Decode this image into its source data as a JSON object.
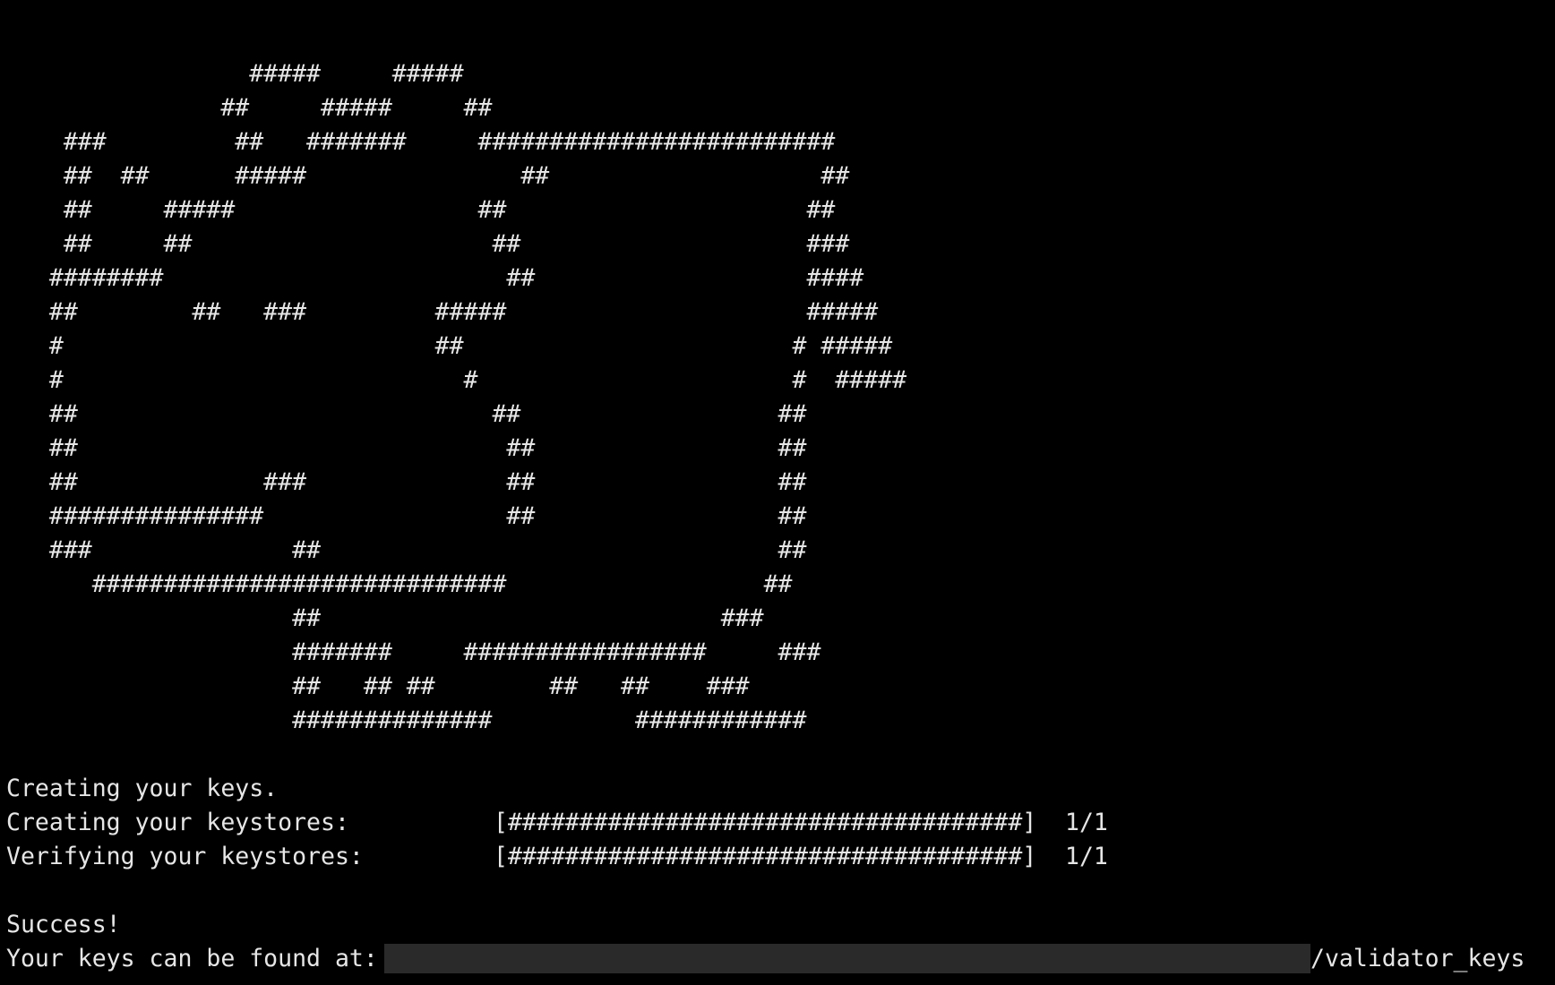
{
  "banner_art": [
    "                 #####     #####",
    "               ##     #####     ##",
    "    ###         ##   #######     #########################",
    "    ##  ##      #####               ##                   ##",
    "    ##     #####                 ##                     ##",
    "    ##     ##                     ##                    ###",
    "   ########                        ##                   ####",
    "   ##        ##   ###         #####                     #####",
    "   #                          ##                       # #####",
    "   #                            #                      #  #####",
    "   ##                             ##                  ##",
    "   ##                              ##                 ##",
    "   ##             ###              ##                 ##",
    "   ###############                 ##                 ##",
    "   ###              ##                                ##",
    "      #############################                  ##",
    "                    ##                            ###",
    "                    #######     #################     ###",
    "                    ##   ## ##        ##   ##    ###",
    "                    ##############          ############"
  ],
  "output": {
    "creating_keys": "Creating your keys.",
    "keystores_create": {
      "label": "Creating your keystores:",
      "bar": "[####################################]",
      "count": "1/1",
      "progress": 1.0
    },
    "keystores_verify": {
      "label": "Verifying your keystores:",
      "bar": "[####################################]",
      "count": "1/1",
      "progress": 1.0
    },
    "success": "Success!",
    "keys_location_label": "Your keys can be found at:",
    "keys_location_suffix": "/validator_keys"
  },
  "colors": {
    "background": "#000000",
    "text": "#e6e6e6",
    "redaction": "#2a2a2a"
  }
}
